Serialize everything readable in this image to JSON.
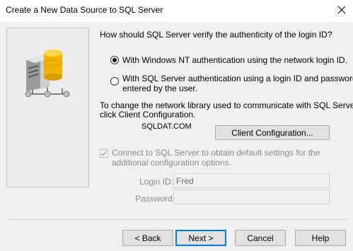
{
  "window": {
    "title": "Create a New Data Source to SQL Server",
    "close_label": "✕"
  },
  "auth": {
    "question": "How should SQL Server verify the authenticity of the login ID?",
    "option_windows_nt": "With Windows NT authentication using the network login ID.",
    "option_sql_server_line1": "With SQL Server authentication using a login ID and password",
    "option_sql_server_line2": "entered by the user.",
    "selected": "windows_nt"
  },
  "network": {
    "instruction_line1": "To change the network library used to communicate with SQL Server,",
    "instruction_line2": "click Client Configuration.",
    "watermark": "SQLDAT.COM",
    "client_config_label": "Client Configuration..."
  },
  "connect": {
    "checkbox_line1": "Connect to SQL Server to obtain default settings for the",
    "checkbox_line2": "additional configuration options.",
    "checked": true,
    "enabled": false
  },
  "login": {
    "login_id_label": "Login ID:",
    "login_id_value": "Fred",
    "password_label": "Password:",
    "password_value": ""
  },
  "buttons": {
    "back": "< Back",
    "next": "Next >",
    "cancel": "Cancel",
    "help": "Help"
  },
  "colors": {
    "focus_border": "#0078d7",
    "dialog_bg": "#f0f0f0",
    "server_gold": "#f0b400"
  }
}
